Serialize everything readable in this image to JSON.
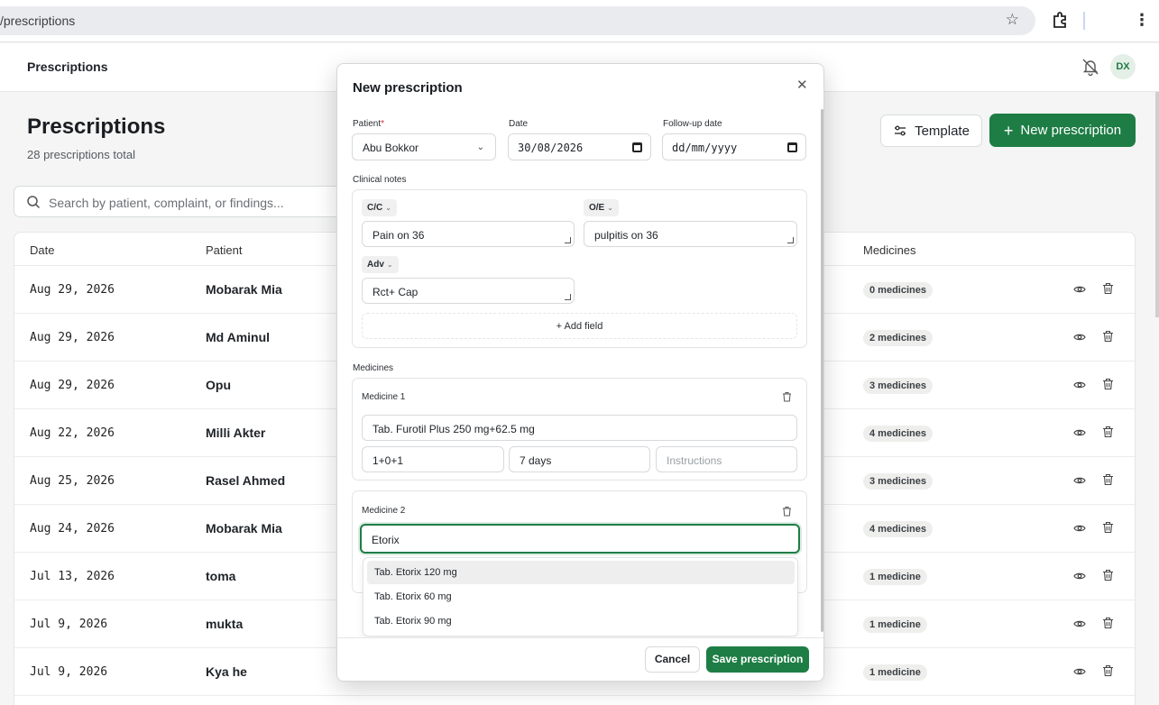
{
  "browser": {
    "url": "/prescriptions"
  },
  "topbar": {
    "title": "Prescriptions",
    "avatar_initials": "DX"
  },
  "page": {
    "title": "Prescriptions",
    "subtitle": "28 prescriptions total",
    "template_button": "Template",
    "new_button": "New prescription",
    "search_placeholder": "Search by patient, complaint, or findings..."
  },
  "table": {
    "headers": {
      "date": "Date",
      "patient": "Patient",
      "medicines": "Medicines"
    },
    "rows": [
      {
        "date": "Aug 29, 2026",
        "patient": "Mobarak Mia",
        "medicines": "0 medicines"
      },
      {
        "date": "Aug 29, 2026",
        "patient": "Md Aminul",
        "medicines": "2 medicines"
      },
      {
        "date": "Aug 29, 2026",
        "patient": "Opu",
        "medicines": "3 medicines"
      },
      {
        "date": "Aug 22, 2026",
        "patient": "Milli Akter",
        "medicines": "4 medicines"
      },
      {
        "date": "Aug 25, 2026",
        "patient": "Rasel Ahmed",
        "medicines": "3 medicines"
      },
      {
        "date": "Aug 24, 2026",
        "patient": "Mobarak Mia",
        "medicines": "4 medicines"
      },
      {
        "date": "Jul 13, 2026",
        "patient": "toma",
        "medicines": "1 medicine"
      },
      {
        "date": "Jul 9, 2026",
        "patient": "mukta",
        "medicines": "1 medicine"
      },
      {
        "date": "Jul 9, 2026",
        "patient": "Kya he",
        "medicines": "1 medicine"
      }
    ]
  },
  "modal": {
    "title": "New prescription",
    "patient_label": "Patient",
    "patient_value": "Abu Bokkor",
    "date_label": "Date",
    "date_value": "30/08/2026",
    "followup_label": "Follow-up date",
    "followup_placeholder": "dd/mm/yyyy",
    "clinical_label": "Clinical notes",
    "notes": [
      {
        "tag": "C/C",
        "value": "Pain on 36"
      },
      {
        "tag": "O/E",
        "value": "pulpitis on 36"
      },
      {
        "tag": "Adv",
        "value": "Rct+ Cap"
      }
    ],
    "add_field": "Add field",
    "medicines_label": "Medicines",
    "medicine1": {
      "title": "Medicine 1",
      "name": "Tab. Furotil Plus 250 mg+62.5 mg",
      "dose": "1+0+1",
      "duration": "7 days",
      "instructions_placeholder": "Instructions"
    },
    "medicine2": {
      "title": "Medicine 2",
      "name": "Etorix"
    },
    "suggestions": [
      "Tab. Etorix 120 mg",
      "Tab. Etorix 60 mg",
      "Tab. Etorix 90 mg"
    ],
    "cancel": "Cancel",
    "save": "Save prescription"
  },
  "colors": {
    "primary": "#1e7d45",
    "focus_ring": "#1e7d45"
  }
}
